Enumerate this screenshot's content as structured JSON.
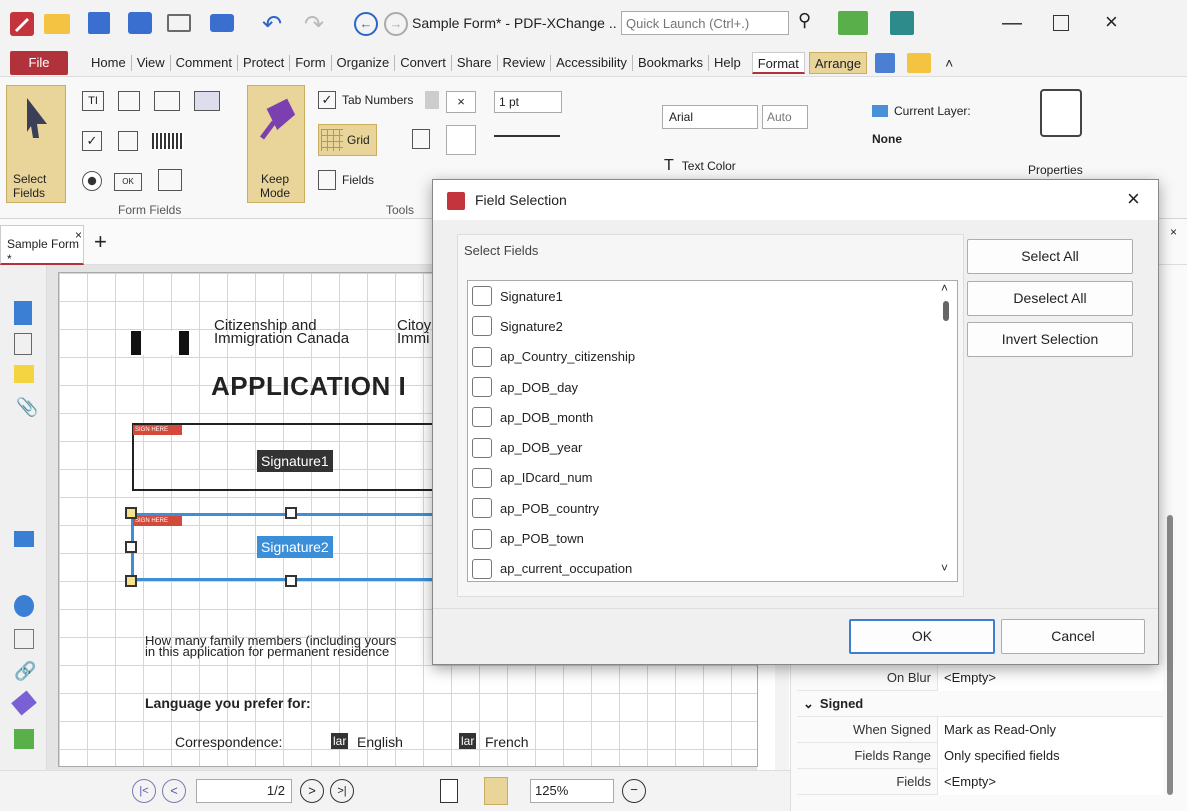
{
  "window": {
    "title": "Sample Form* - PDF-XChange ..",
    "quick_launch_placeholder": "Quick Launch (Ctrl+.)"
  },
  "menu": {
    "file": "File",
    "items": [
      "Home",
      "View",
      "Comment",
      "Protect",
      "Form",
      "Organize",
      "Convert",
      "Share",
      "Review",
      "Accessibility",
      "Bookmarks",
      "Help"
    ],
    "format": "Format",
    "arrange": "Arrange"
  },
  "ribbon": {
    "select_fields": "Select\nFields",
    "keep_mode": "Keep\nMode",
    "group_form_fields": "Form Fields",
    "group_tools": "Tools",
    "tab_numbers": "Tab Numbers",
    "grid": "Grid",
    "fields": "Fields",
    "line_width": "1 pt",
    "font": "Arial",
    "font_size": "Auto",
    "text_color": "Text Color",
    "current_layer": "Current Layer:",
    "layer_value": "None",
    "properties": "Properties"
  },
  "doc_tab": {
    "label": "Sample Form *"
  },
  "page": {
    "agency_en_1": "Citizenship and",
    "agency_en_2": "Immigration Canada",
    "agency_fr_1": "Citoy",
    "agency_fr_2": "Immi",
    "heading": "APPLICATION I",
    "sig1": "Signature1",
    "sig2": "Signature2",
    "sig_tag": "SIGN HERE",
    "q1": "How many family members (including yours",
    "q2": "in this application for permanent residence",
    "lang_label": "Language you prefer for:",
    "correspondence": "Correspondence:",
    "lar": "lar",
    "english": "English",
    "french": "French"
  },
  "bottom": {
    "page_display": "1/2",
    "zoom": "125%"
  },
  "properties": [
    {
      "key": "On Blur",
      "value": "<Empty>"
    },
    {
      "section": "Signed"
    },
    {
      "key": "When Signed",
      "value": "Mark as Read-Only"
    },
    {
      "key": "Fields Range",
      "value": "Only specified fields"
    },
    {
      "key": "Fields",
      "value": "<Empty>"
    }
  ],
  "dialog": {
    "title": "Field Selection",
    "group_label": "Select Fields",
    "fields": [
      "Signature1",
      "Signature2",
      "ap_Country_citizenship",
      "ap_DOB_day",
      "ap_DOB_month",
      "ap_DOB_year",
      "ap_IDcard_num",
      "ap_POB_country",
      "ap_POB_town",
      "ap_current_occupation"
    ],
    "select_all": "Select All",
    "deselect_all": "Deselect All",
    "invert_selection": "Invert Selection",
    "ok": "OK",
    "cancel": "Cancel"
  },
  "colors": {
    "accent": "#b2323c",
    "selection_blue": "#3b8fd9",
    "ribbon_highlight": "#e9d49a"
  }
}
